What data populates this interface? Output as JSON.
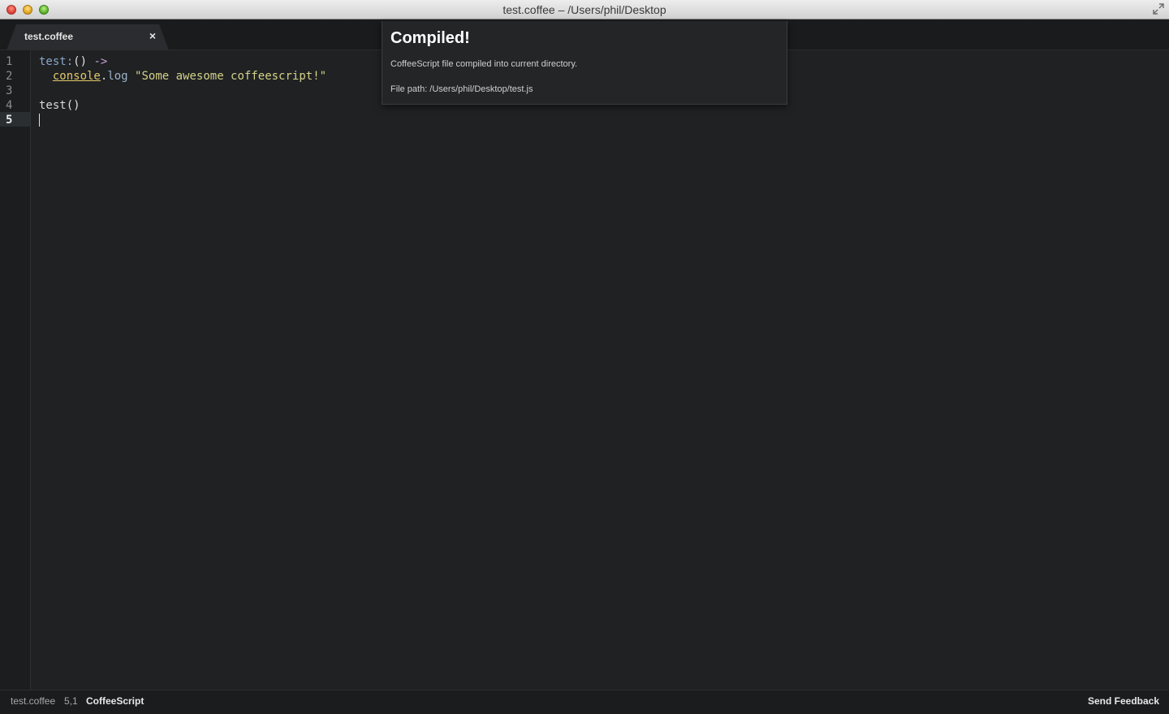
{
  "window": {
    "title": "test.coffee – /Users/phil/Desktop"
  },
  "tabs": [
    {
      "label": "test.coffee",
      "close_label": "×"
    }
  ],
  "editor": {
    "line_numbers": [
      "1",
      "2",
      "3",
      "4",
      "5"
    ],
    "active_line": "5",
    "lines": {
      "l1": {
        "fn": "test",
        "sep": ":",
        "paren": "()",
        "arrow": " ->"
      },
      "l2": {
        "indent": "  ",
        "obj": "console",
        "dot": ".",
        "method": "log",
        "space": " ",
        "string": "\"Some awesome coffeescript!\""
      },
      "l3": "",
      "l4": {
        "fn": "test",
        "paren": "()"
      },
      "l5": ""
    }
  },
  "notification": {
    "title": "Compiled!",
    "body": "CoffeeScript file compiled into current directory.",
    "path": "File path: /Users/phil/Desktop/test.js"
  },
  "status": {
    "file": "test.coffee",
    "position": "5,1",
    "grammar": "CoffeeScript",
    "feedback": "Send Feedback"
  },
  "colors": {
    "background": "#1f2123",
    "string": "#d6d28a",
    "console": "#e2c86a",
    "function": "#8aa6c9",
    "arrow": "#c3a0d8"
  }
}
